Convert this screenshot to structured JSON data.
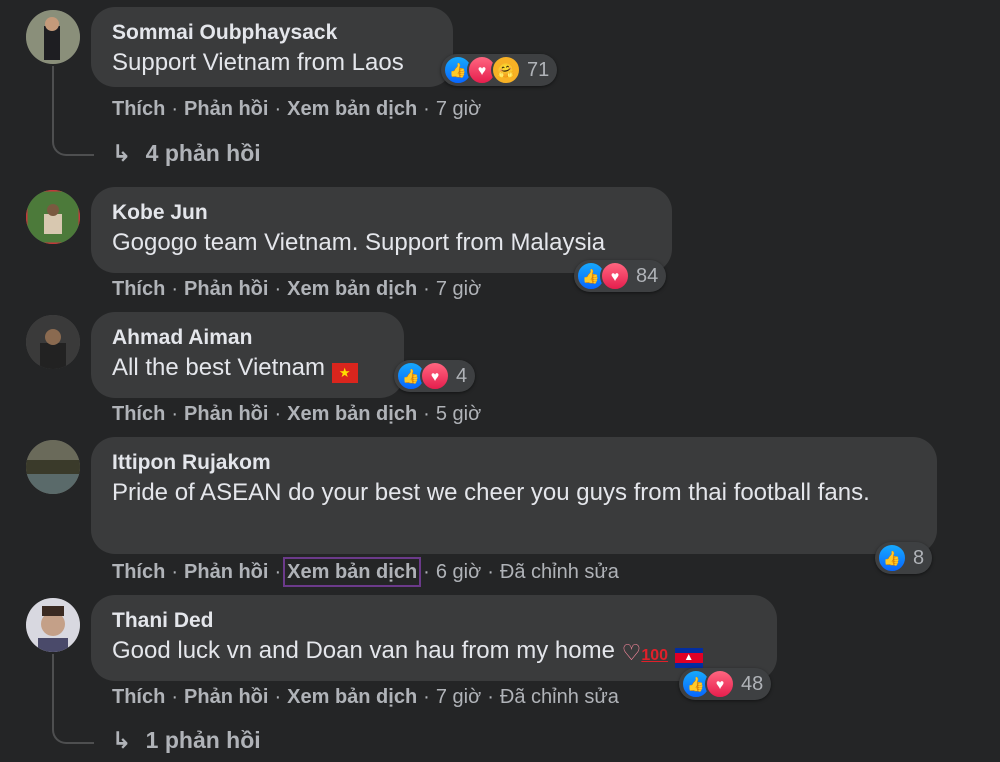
{
  "comments": [
    {
      "author": "Sommai Oubphaysack",
      "text": "Support Vietnam from Laos",
      "actions": [
        "Thích",
        "Phản hồi",
        "Xem bản dịch"
      ],
      "time": "7 giờ",
      "reaction_count": "71",
      "replies": "4 phản hồi"
    },
    {
      "author": "Kobe Jun",
      "text": "Gogogo team Vietnam. Support from Malaysia",
      "actions": [
        "Thích",
        "Phản hồi",
        "Xem bản dịch"
      ],
      "time": "7 giờ",
      "reaction_count": "84"
    },
    {
      "author": "Ahmad Aiman",
      "text": "All the best Vietnam",
      "actions": [
        "Thích",
        "Phản hồi",
        "Xem bản dịch"
      ],
      "time": "5 giờ",
      "reaction_count": "4"
    },
    {
      "author": "Ittipon Rujakom",
      "text": "Pride of ASEAN do your best we cheer you guys from thai football fans.",
      "actions": [
        "Thích",
        "Phản hồi",
        "Xem bản dịch"
      ],
      "time": "6 giờ",
      "edited": "Đã chỉnh sửa",
      "reaction_count": "8"
    },
    {
      "author": "Thani Ded",
      "text": "Good luck vn and Doan van hau from my home",
      "actions": [
        "Thích",
        "Phản hồi",
        "Xem bản dịch"
      ],
      "time": "7 giờ",
      "edited": "Đã chỉnh sửa",
      "reaction_count": "48",
      "replies": "1 phản hồi"
    }
  ],
  "icons": {
    "like": "thumbs-up-icon",
    "love": "heart-icon",
    "care": "care-icon",
    "reply_arrow": "reply-arrow-icon"
  },
  "colors": {
    "background": "#242526",
    "bubble": "#3a3b3c",
    "like_blue": "#0866ff",
    "love_red": "#e61e4d"
  }
}
